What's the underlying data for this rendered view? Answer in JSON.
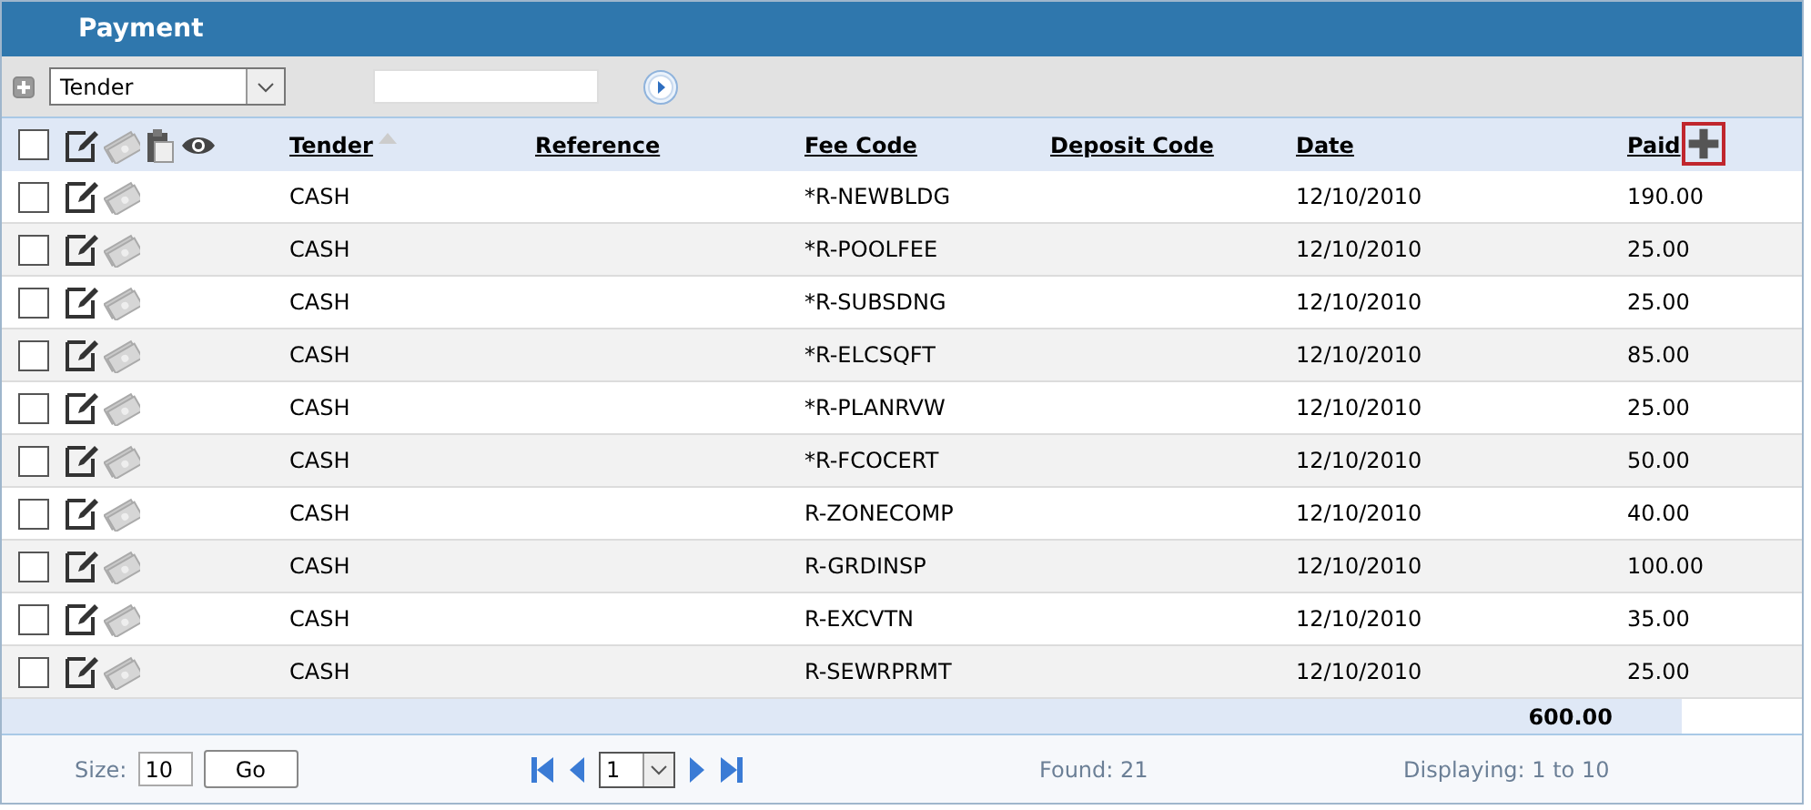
{
  "panel": {
    "title": "Payment"
  },
  "filter": {
    "field": "Tender"
  },
  "table": {
    "select_all_checked": false,
    "columns": [
      {
        "label": "Tender",
        "sorted": true
      },
      {
        "label": "Reference",
        "sorted": false
      },
      {
        "label": "Fee Code",
        "sorted": false
      },
      {
        "label": "Deposit Code",
        "sorted": false
      },
      {
        "label": "Date",
        "sorted": false
      },
      {
        "label": "Paid",
        "sorted": false
      }
    ],
    "rows": [
      {
        "checked": false,
        "tender": "CASH",
        "fee_code": "*R-NEWBLDG",
        "date": "12/10/2010",
        "paid": "190.00"
      },
      {
        "checked": false,
        "tender": "CASH",
        "fee_code": "*R-POOLFEE",
        "date": "12/10/2010",
        "paid": "25.00"
      },
      {
        "checked": false,
        "tender": "CASH",
        "fee_code": "*R-SUBSDNG",
        "date": "12/10/2010",
        "paid": "25.00"
      },
      {
        "checked": false,
        "tender": "CASH",
        "fee_code": "*R-ELCSQFT",
        "date": "12/10/2010",
        "paid": "85.00"
      },
      {
        "checked": false,
        "tender": "CASH",
        "fee_code": "*R-PLANRVW",
        "date": "12/10/2010",
        "paid": "25.00"
      },
      {
        "checked": false,
        "tender": "CASH",
        "fee_code": "*R-FCOCERT",
        "date": "12/10/2010",
        "paid": "50.00"
      },
      {
        "checked": false,
        "tender": "CASH",
        "fee_code": "R-ZONECOMP",
        "date": "12/10/2010",
        "paid": "40.00"
      },
      {
        "checked": false,
        "tender": "CASH",
        "fee_code": "R-GRDINSP",
        "date": "12/10/2010",
        "paid": "100.00"
      },
      {
        "checked": false,
        "tender": "CASH",
        "fee_code": "R-EXCVTN",
        "date": "12/10/2010",
        "paid": "35.00"
      },
      {
        "checked": false,
        "tender": "CASH",
        "fee_code": "R-SEWRPRMT",
        "date": "12/10/2010",
        "paid": "25.00"
      }
    ],
    "total": "600.00"
  },
  "pager": {
    "size_label": "Size:",
    "size": "10",
    "go": "Go",
    "page": "1",
    "found": "Found: 21",
    "displaying": "Displaying: 1 to 10"
  }
}
